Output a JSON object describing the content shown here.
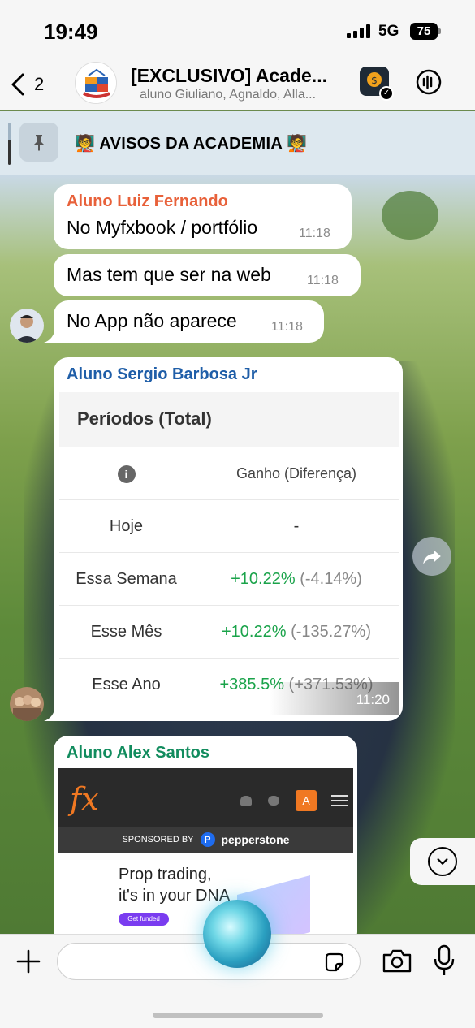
{
  "status": {
    "time": "19:49",
    "network": "5G",
    "battery": "75"
  },
  "header": {
    "back_count": "2",
    "title": "[EXCLUSIVO] Acade...",
    "subtitle": "aluno Giuliano, Agnaldo, Alla..."
  },
  "pinned": {
    "text": "🧑‍🏫 AVISOS DA ACADEMIA 🧑‍🏫"
  },
  "messages": [
    {
      "sender": "Aluno Luiz Fernando",
      "sender_color": "#e8613a",
      "text": "No Myfxbook / portfólio",
      "time": "11:18"
    },
    {
      "text": "Mas tem que ser na web",
      "time": "11:18"
    },
    {
      "text": "No App não aparece",
      "time": "11:18"
    }
  ],
  "image_message": {
    "sender": "Aluno Sergio Barbosa Jr",
    "sender_color": "#1f5ea8",
    "time": "11:20",
    "table": {
      "title": "Períodos (Total)",
      "header": {
        "info_icon": "info-icon",
        "col2": "Ganho (Diferença)"
      },
      "rows": [
        {
          "label": "Hoje",
          "gain": "-",
          "diff": ""
        },
        {
          "label": "Essa Semana",
          "gain": "+10.22%",
          "diff": "(-4.14%)"
        },
        {
          "label": "Esse Mês",
          "gain": "+10.22%",
          "diff": "(-135.27%)"
        },
        {
          "label": "Esse Ano",
          "gain": "+385.5%",
          "diff": "(+371.53%)"
        }
      ]
    }
  },
  "fx_message": {
    "sender": "Aluno Alex Santos",
    "sender_color": "#128c5e",
    "logo": "fx",
    "avatar_letter": "A",
    "sponsored_by": "SPONSORED BY",
    "sponsor": "pepperstone",
    "headline_line1": "Prop trading,",
    "headline_line2": "it's in your DNA",
    "cta": "Get funded"
  },
  "composer": {
    "placeholder": ""
  },
  "colors": {
    "accent_green": "#1aa34a",
    "header_bg": "#f6f6f6"
  }
}
